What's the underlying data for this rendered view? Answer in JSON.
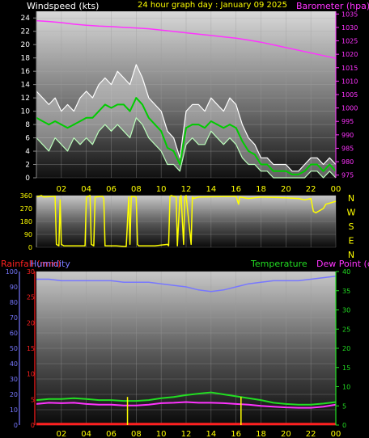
{
  "header": {
    "windspeed_label": "Windspeed (kts)",
    "date_label": "24 hour graph day : January 09 2025",
    "barometer_label": "Barometer (hpa)"
  },
  "compass": {
    "letters": [
      "N",
      "W",
      "S",
      "E",
      "N"
    ]
  },
  "lower_header": {
    "rainfall_label": "Rainfall (mm)",
    "humidity_label": "Humidity",
    "temperature_label": "Temperature",
    "dewpoint_label": "Dew Point (c)"
  },
  "colors": {
    "windspeed_label": "#ffffff",
    "barometer": "#ff33ff",
    "date_label": "#ffff00",
    "wind_dir": "#ffff00",
    "rainfall": "#ff2020",
    "humidity": "#7777ff",
    "temperature": "#22dd22",
    "dewpoint": "#ff33ff",
    "gust": "#ffffff",
    "wind": "#bbffbb",
    "wind_avg": "#00cc00"
  },
  "chart_data": [
    {
      "type": "line",
      "name": "wind-and-pressure",
      "x_ticks": [
        "02",
        "04",
        "06",
        "08",
        "10",
        "12",
        "14",
        "16",
        "18",
        "20",
        "22",
        "00"
      ],
      "y_left_ticks": [
        0,
        2,
        4,
        6,
        8,
        10,
        12,
        14,
        16,
        18,
        20,
        22,
        24
      ],
      "y_left_range": [
        0,
        25
      ],
      "y_right_ticks": [
        975,
        980,
        985,
        990,
        995,
        1000,
        1005,
        1010,
        1015,
        1020,
        1025,
        1030,
        1035
      ],
      "y_right_range": [
        974,
        1036
      ],
      "x_range": [
        0,
        24
      ],
      "series": [
        {
          "role": "barometer",
          "x": [
            0,
            1,
            2,
            3,
            4,
            5,
            6,
            7,
            8,
            9,
            10,
            11,
            12,
            13,
            14,
            15,
            16,
            17,
            18,
            19,
            20,
            21,
            22,
            23,
            24
          ],
          "values": [
            1032.5,
            1032.2,
            1031.8,
            1031.2,
            1030.8,
            1030.5,
            1030.3,
            1030.0,
            1029.8,
            1029.5,
            1029.0,
            1028.5,
            1028.0,
            1027.5,
            1027.0,
            1026.5,
            1026.0,
            1025.3,
            1024.5,
            1023.5,
            1022.5,
            1021.5,
            1020.5,
            1019.5,
            1018.5
          ]
        },
        {
          "role": "gust",
          "x": [
            0,
            0.5,
            1,
            1.5,
            2,
            2.5,
            3,
            3.5,
            4,
            4.5,
            5,
            5.5,
            6,
            6.5,
            7,
            7.5,
            8,
            8.5,
            9,
            9.5,
            10,
            10.5,
            11,
            11.5,
            12,
            12.5,
            13,
            13.5,
            14,
            14.5,
            15,
            15.5,
            16,
            16.5,
            17,
            17.5,
            18,
            18.5,
            19,
            19.5,
            20,
            20.5,
            21,
            21.5,
            22,
            22.5,
            23,
            23.5,
            24
          ],
          "values": [
            13,
            12,
            11,
            12,
            10,
            11,
            10,
            12,
            13,
            12,
            14,
            15,
            14,
            16,
            15,
            14,
            17,
            15,
            12,
            11,
            10,
            7,
            6,
            3,
            10,
            11,
            11,
            10,
            12,
            11,
            10,
            12,
            11,
            8,
            6,
            5,
            3,
            3,
            2,
            2,
            2,
            1,
            1,
            2,
            3,
            3,
            2,
            3,
            2
          ]
        },
        {
          "role": "wind",
          "x": [
            0,
            0.5,
            1,
            1.5,
            2,
            2.5,
            3,
            3.5,
            4,
            4.5,
            5,
            5.5,
            6,
            6.5,
            7,
            7.5,
            8,
            8.5,
            9,
            9.5,
            10,
            10.5,
            11,
            11.5,
            12,
            12.5,
            13,
            13.5,
            14,
            14.5,
            15,
            15.5,
            16,
            16.5,
            17,
            17.5,
            18,
            18.5,
            19,
            19.5,
            20,
            20.5,
            21,
            21.5,
            22,
            22.5,
            23,
            23.5,
            24
          ],
          "values": [
            6,
            5,
            4,
            6,
            5,
            4,
            6,
            5,
            6,
            5,
            7,
            8,
            7,
            8,
            7,
            6,
            9,
            8,
            6,
            5,
            4,
            2,
            2,
            1,
            5,
            6,
            5,
            5,
            7,
            6,
            5,
            6,
            5,
            3,
            2,
            2,
            1,
            1,
            0,
            0,
            0,
            0,
            0,
            0,
            1,
            1,
            0,
            1,
            0
          ]
        },
        {
          "role": "wind-average",
          "x": [
            0,
            0.5,
            1,
            1.5,
            2,
            2.5,
            3,
            3.5,
            4,
            4.5,
            5,
            5.5,
            6,
            6.5,
            7,
            7.5,
            8,
            8.5,
            9,
            9.5,
            10,
            10.5,
            11,
            11.5,
            12,
            12.5,
            13,
            13.5,
            14,
            14.5,
            15,
            15.5,
            16,
            16.5,
            17,
            17.5,
            18,
            18.5,
            19,
            19.5,
            20,
            20.5,
            21,
            21.5,
            22,
            22.5,
            23,
            23.5,
            24
          ],
          "values": [
            9,
            8.5,
            8,
            8.5,
            8,
            7.5,
            8,
            8.5,
            9,
            9,
            10,
            11,
            10.5,
            11,
            11,
            10,
            12,
            11,
            9,
            8,
            7,
            4.5,
            4,
            2,
            7.5,
            8,
            8,
            7.5,
            8.5,
            8,
            7.5,
            8,
            7.5,
            5.5,
            4,
            3.5,
            2,
            2,
            1,
            1,
            1,
            0.5,
            0.5,
            1,
            2,
            2,
            1,
            2,
            1
          ]
        }
      ]
    },
    {
      "type": "line",
      "name": "wind-direction",
      "x_ticks": [],
      "y_ticks": [
        0,
        90,
        180,
        270,
        360
      ],
      "y_range": [
        0,
        360
      ],
      "x_range": [
        0,
        24
      ],
      "series": [
        {
          "role": "wind-direction",
          "x": [
            0,
            0.4,
            0.6,
            1.5,
            1.6,
            1.8,
            1.9,
            2.0,
            2.2,
            2.4,
            3.9,
            4.0,
            4.3,
            4.4,
            4.6,
            4.7,
            5.3,
            5.4,
            5.5,
            6.2,
            6.4,
            7.2,
            7.4,
            7.5,
            7.6,
            8.0,
            8.1,
            8.2,
            9.5,
            10.0,
            10.5,
            10.6,
            10.7,
            10.8,
            11.2,
            11.3,
            11.5,
            11.6,
            11.8,
            11.9,
            12.0,
            12.4,
            12.5,
            12.6,
            13.0,
            16.0,
            16.2,
            16.3,
            17.0,
            18.0,
            20.0,
            21.0,
            21.5,
            22.0,
            22.2,
            22.4,
            23.0,
            23.2,
            24.0
          ],
          "values": [
            350,
            360,
            350,
            355,
            20,
            10,
            330,
            20,
            10,
            10,
            10,
            350,
            360,
            20,
            10,
            350,
            355,
            340,
            10,
            10,
            10,
            5,
            350,
            20,
            355,
            350,
            20,
            10,
            10,
            15,
            20,
            10,
            355,
            360,
            350,
            10,
            350,
            360,
            20,
            350,
            360,
            20,
            350,
            340,
            350,
            355,
            300,
            350,
            340,
            350,
            345,
            340,
            330,
            340,
            250,
            240,
            270,
            300,
            320
          ]
        }
      ]
    },
    {
      "type": "line",
      "name": "humidity-temperature-rain",
      "x_ticks": [
        "02",
        "04",
        "06",
        "08",
        "10",
        "12",
        "14",
        "16",
        "18",
        "20",
        "22",
        "00"
      ],
      "y_left_ticks": [
        0,
        10,
        20,
        30,
        40,
        50,
        60,
        70,
        80,
        90,
        100
      ],
      "y_left_range": [
        0,
        100
      ],
      "y_rain_ticks": [
        0,
        5,
        10,
        15,
        20,
        25,
        30
      ],
      "y_rain_range": [
        0,
        30
      ],
      "y_right_ticks": [
        0,
        5,
        10,
        15,
        20,
        25,
        30,
        35,
        40
      ],
      "y_right_range": [
        0,
        40
      ],
      "x_range": [
        0,
        24
      ],
      "series": [
        {
          "role": "humidity",
          "x": [
            0,
            1,
            2,
            3,
            4,
            5,
            6,
            7,
            8,
            9,
            10,
            11,
            12,
            13,
            14,
            15,
            16,
            17,
            18,
            19,
            20,
            21,
            22,
            23,
            24
          ],
          "values": [
            95,
            95,
            94,
            94,
            94,
            94,
            94,
            93,
            93,
            93,
            92,
            91,
            90,
            88,
            87,
            88,
            90,
            92,
            93,
            94,
            94,
            94,
            95,
            96,
            97
          ]
        },
        {
          "role": "temperature",
          "x": [
            0,
            1,
            2,
            3,
            4,
            5,
            6,
            7,
            8,
            9,
            10,
            11,
            12,
            13,
            14,
            15,
            16,
            17,
            18,
            19,
            20,
            21,
            22,
            23,
            24
          ],
          "values": [
            6.5,
            6.8,
            6.8,
            7.0,
            6.8,
            6.5,
            6.5,
            6.3,
            6.3,
            6.5,
            7.0,
            7.3,
            7.8,
            8.2,
            8.5,
            8.0,
            7.5,
            7.0,
            6.5,
            5.8,
            5.5,
            5.3,
            5.3,
            5.6,
            6.0
          ]
        },
        {
          "role": "dewpoint",
          "x": [
            0,
            1,
            2,
            3,
            4,
            5,
            6,
            7,
            8,
            9,
            10,
            11,
            12,
            13,
            14,
            15,
            16,
            17,
            18,
            19,
            20,
            21,
            22,
            23,
            24
          ],
          "values": [
            5.5,
            5.8,
            5.7,
            5.8,
            5.5,
            5.3,
            5.3,
            5.1,
            5.1,
            5.3,
            5.7,
            5.8,
            6.0,
            5.8,
            5.8,
            5.7,
            5.5,
            5.3,
            5.0,
            4.8,
            4.6,
            4.5,
            4.5,
            4.8,
            5.3
          ]
        },
        {
          "role": "rainfall",
          "x": [
            0,
            24
          ],
          "values": [
            0.2,
            0.2
          ]
        },
        {
          "role": "rain-rate-spikes",
          "x": [
            7.3,
            16.4
          ],
          "values": [
            5.5,
            5.5
          ]
        }
      ]
    }
  ]
}
